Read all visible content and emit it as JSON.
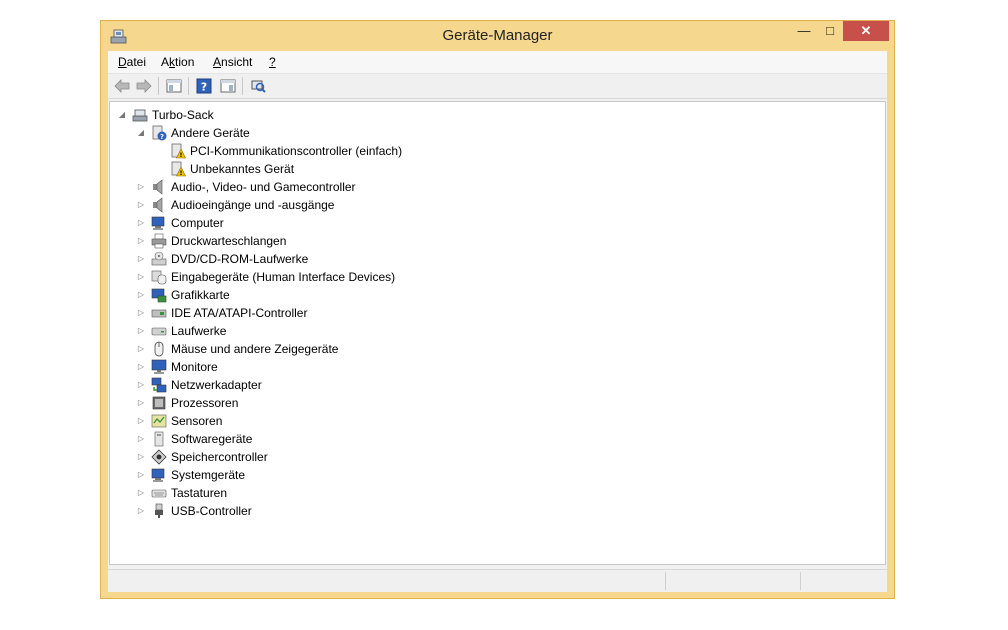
{
  "window": {
    "title": "Geräte-Manager"
  },
  "menu": [
    {
      "label": "Datei",
      "underline": "D"
    },
    {
      "label": "Aktion",
      "underline": "k"
    },
    {
      "label": "Ansicht",
      "underline": "A"
    },
    {
      "label": "?",
      "underline": "?"
    }
  ],
  "tree": {
    "root": "Turbo-Sack",
    "other_devices": {
      "label": "Andere Geräte",
      "children": [
        "PCI-Kommunikationscontroller (einfach)",
        "Unbekanntes Gerät"
      ]
    },
    "categories": [
      {
        "label": "Audio-, Video- und Gamecontroller",
        "icon": "speaker-icon"
      },
      {
        "label": "Audioeingänge und -ausgänge",
        "icon": "speaker-icon"
      },
      {
        "label": "Computer",
        "icon": "computer-icon"
      },
      {
        "label": "Druckwarteschlangen",
        "icon": "printer-icon"
      },
      {
        "label": "DVD/CD-ROM-Laufwerke",
        "icon": "dvd-drive-icon"
      },
      {
        "label": "Eingabegeräte (Human Interface Devices)",
        "icon": "hid-icon"
      },
      {
        "label": "Grafikkarte",
        "icon": "display-adapter-icon"
      },
      {
        "label": "IDE ATA/ATAPI-Controller",
        "icon": "ide-controller-icon"
      },
      {
        "label": "Laufwerke",
        "icon": "disk-drive-icon"
      },
      {
        "label": "Mäuse und andere Zeigegeräte",
        "icon": "mouse-icon"
      },
      {
        "label": "Monitore",
        "icon": "monitor-icon"
      },
      {
        "label": "Netzwerkadapter",
        "icon": "network-adapter-icon"
      },
      {
        "label": "Prozessoren",
        "icon": "processor-icon"
      },
      {
        "label": "Sensoren",
        "icon": "sensor-icon"
      },
      {
        "label": "Softwaregeräte",
        "icon": "software-device-icon"
      },
      {
        "label": "Speichercontroller",
        "icon": "storage-controller-icon"
      },
      {
        "label": "Systemgeräte",
        "icon": "system-device-icon"
      },
      {
        "label": "Tastaturen",
        "icon": "keyboard-icon"
      },
      {
        "label": "USB-Controller",
        "icon": "usb-icon"
      }
    ]
  },
  "colors": {
    "frame": "#f5d78e",
    "close_button": "#c7504a",
    "warning": "#f2c200"
  }
}
